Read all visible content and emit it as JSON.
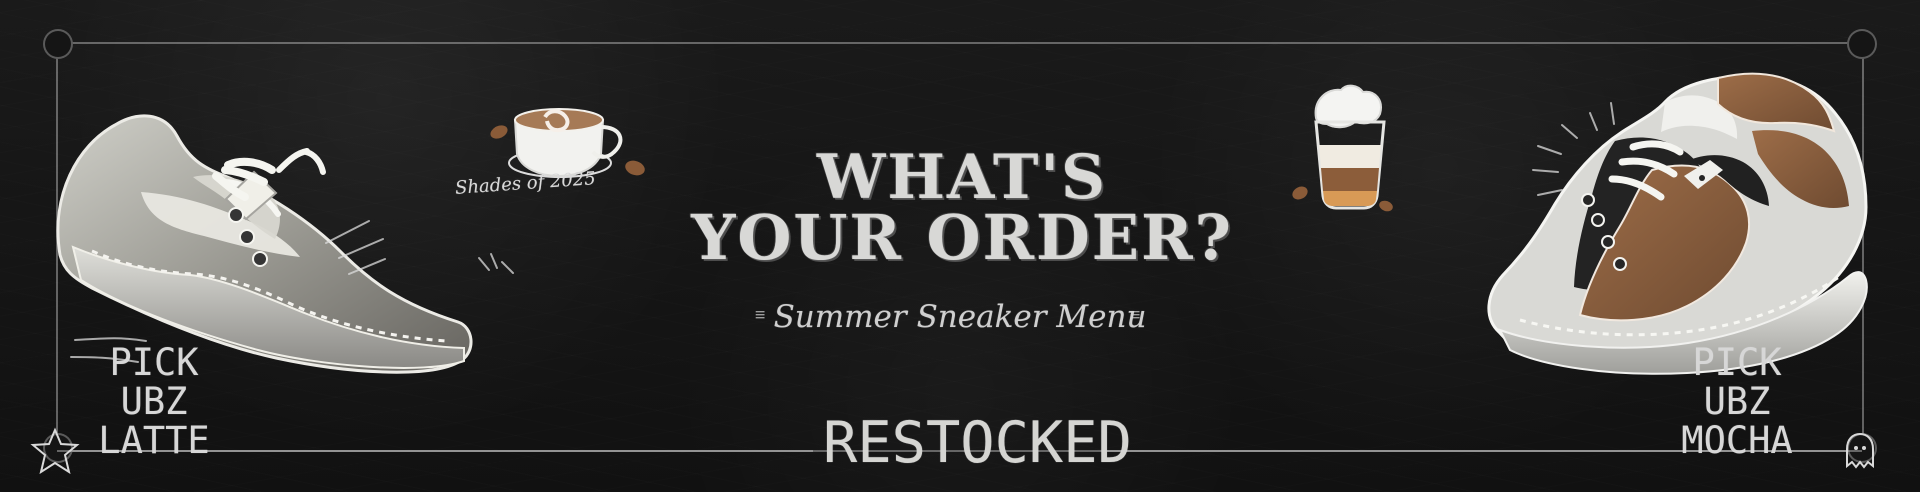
{
  "headline": {
    "line1": "WHAT'S",
    "line2": "YOUR ORDER?"
  },
  "subtitle": "Summer Sneaker Menu",
  "tagline": "Shades of 2025",
  "left_pick": {
    "line1": "PICK UBZ",
    "line2": "LATTE"
  },
  "right_pick": {
    "line1": "PICK UBZ",
    "line2": "MOCHA"
  },
  "footer_word": "RESTOCKED",
  "icons": {
    "left_shoe": "sneaker-illustration-left",
    "right_shoe": "sneaker-illustration-right",
    "coffee_cup": "coffee-cup-icon",
    "drink": "iced-drink-icon",
    "star": "star-icon",
    "ghost": "ghost-icon"
  },
  "colors": {
    "background": "#121212",
    "chalk": "#d8d8d6",
    "left_shoe_main": "#9b9a94",
    "right_shoe_brown": "#7c5434",
    "right_shoe_dark": "#1f1f1f"
  }
}
